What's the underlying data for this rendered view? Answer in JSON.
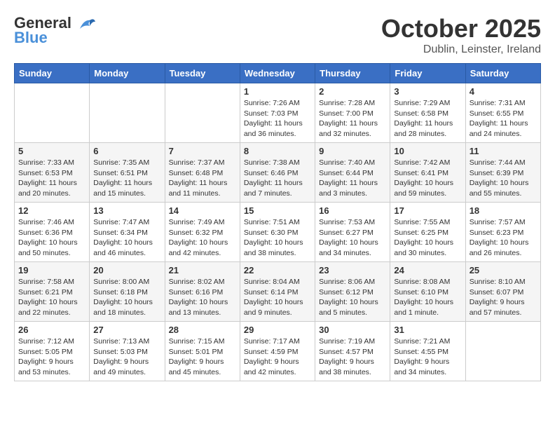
{
  "header": {
    "logo_line1": "General",
    "logo_line2": "Blue",
    "month_title": "October 2025",
    "subtitle": "Dublin, Leinster, Ireland"
  },
  "weekdays": [
    "Sunday",
    "Monday",
    "Tuesday",
    "Wednesday",
    "Thursday",
    "Friday",
    "Saturday"
  ],
  "weeks": [
    [
      {
        "day": "",
        "info": ""
      },
      {
        "day": "",
        "info": ""
      },
      {
        "day": "",
        "info": ""
      },
      {
        "day": "1",
        "info": "Sunrise: 7:26 AM\nSunset: 7:03 PM\nDaylight: 11 hours\nand 36 minutes."
      },
      {
        "day": "2",
        "info": "Sunrise: 7:28 AM\nSunset: 7:00 PM\nDaylight: 11 hours\nand 32 minutes."
      },
      {
        "day": "3",
        "info": "Sunrise: 7:29 AM\nSunset: 6:58 PM\nDaylight: 11 hours\nand 28 minutes."
      },
      {
        "day": "4",
        "info": "Sunrise: 7:31 AM\nSunset: 6:55 PM\nDaylight: 11 hours\nand 24 minutes."
      }
    ],
    [
      {
        "day": "5",
        "info": "Sunrise: 7:33 AM\nSunset: 6:53 PM\nDaylight: 11 hours\nand 20 minutes."
      },
      {
        "day": "6",
        "info": "Sunrise: 7:35 AM\nSunset: 6:51 PM\nDaylight: 11 hours\nand 15 minutes."
      },
      {
        "day": "7",
        "info": "Sunrise: 7:37 AM\nSunset: 6:48 PM\nDaylight: 11 hours\nand 11 minutes."
      },
      {
        "day": "8",
        "info": "Sunrise: 7:38 AM\nSunset: 6:46 PM\nDaylight: 11 hours\nand 7 minutes."
      },
      {
        "day": "9",
        "info": "Sunrise: 7:40 AM\nSunset: 6:44 PM\nDaylight: 11 hours\nand 3 minutes."
      },
      {
        "day": "10",
        "info": "Sunrise: 7:42 AM\nSunset: 6:41 PM\nDaylight: 10 hours\nand 59 minutes."
      },
      {
        "day": "11",
        "info": "Sunrise: 7:44 AM\nSunset: 6:39 PM\nDaylight: 10 hours\nand 55 minutes."
      }
    ],
    [
      {
        "day": "12",
        "info": "Sunrise: 7:46 AM\nSunset: 6:36 PM\nDaylight: 10 hours\nand 50 minutes."
      },
      {
        "day": "13",
        "info": "Sunrise: 7:47 AM\nSunset: 6:34 PM\nDaylight: 10 hours\nand 46 minutes."
      },
      {
        "day": "14",
        "info": "Sunrise: 7:49 AM\nSunset: 6:32 PM\nDaylight: 10 hours\nand 42 minutes."
      },
      {
        "day": "15",
        "info": "Sunrise: 7:51 AM\nSunset: 6:30 PM\nDaylight: 10 hours\nand 38 minutes."
      },
      {
        "day": "16",
        "info": "Sunrise: 7:53 AM\nSunset: 6:27 PM\nDaylight: 10 hours\nand 34 minutes."
      },
      {
        "day": "17",
        "info": "Sunrise: 7:55 AM\nSunset: 6:25 PM\nDaylight: 10 hours\nand 30 minutes."
      },
      {
        "day": "18",
        "info": "Sunrise: 7:57 AM\nSunset: 6:23 PM\nDaylight: 10 hours\nand 26 minutes."
      }
    ],
    [
      {
        "day": "19",
        "info": "Sunrise: 7:58 AM\nSunset: 6:21 PM\nDaylight: 10 hours\nand 22 minutes."
      },
      {
        "day": "20",
        "info": "Sunrise: 8:00 AM\nSunset: 6:18 PM\nDaylight: 10 hours\nand 18 minutes."
      },
      {
        "day": "21",
        "info": "Sunrise: 8:02 AM\nSunset: 6:16 PM\nDaylight: 10 hours\nand 13 minutes."
      },
      {
        "day": "22",
        "info": "Sunrise: 8:04 AM\nSunset: 6:14 PM\nDaylight: 10 hours\nand 9 minutes."
      },
      {
        "day": "23",
        "info": "Sunrise: 8:06 AM\nSunset: 6:12 PM\nDaylight: 10 hours\nand 5 minutes."
      },
      {
        "day": "24",
        "info": "Sunrise: 8:08 AM\nSunset: 6:10 PM\nDaylight: 10 hours\nand 1 minute."
      },
      {
        "day": "25",
        "info": "Sunrise: 8:10 AM\nSunset: 6:07 PM\nDaylight: 9 hours\nand 57 minutes."
      }
    ],
    [
      {
        "day": "26",
        "info": "Sunrise: 7:12 AM\nSunset: 5:05 PM\nDaylight: 9 hours\nand 53 minutes."
      },
      {
        "day": "27",
        "info": "Sunrise: 7:13 AM\nSunset: 5:03 PM\nDaylight: 9 hours\nand 49 minutes."
      },
      {
        "day": "28",
        "info": "Sunrise: 7:15 AM\nSunset: 5:01 PM\nDaylight: 9 hours\nand 45 minutes."
      },
      {
        "day": "29",
        "info": "Sunrise: 7:17 AM\nSunset: 4:59 PM\nDaylight: 9 hours\nand 42 minutes."
      },
      {
        "day": "30",
        "info": "Sunrise: 7:19 AM\nSunset: 4:57 PM\nDaylight: 9 hours\nand 38 minutes."
      },
      {
        "day": "31",
        "info": "Sunrise: 7:21 AM\nSunset: 4:55 PM\nDaylight: 9 hours\nand 34 minutes."
      },
      {
        "day": "",
        "info": ""
      }
    ]
  ]
}
